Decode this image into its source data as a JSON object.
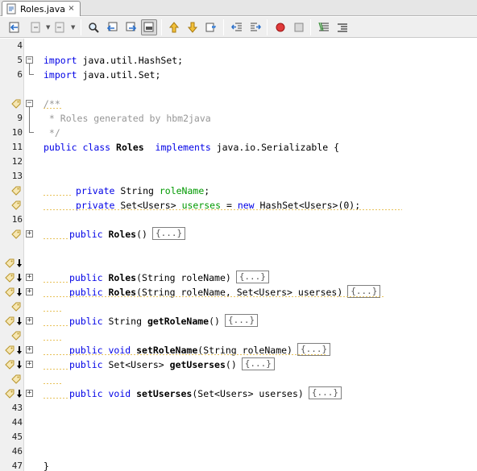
{
  "tab": {
    "label": "Roles.java",
    "close": "×"
  },
  "toolbar": {
    "buttons": [
      "last-edit-icon",
      "back-icon",
      "forward-icon",
      "find-selection-icon",
      "find-previous-icon",
      "find-next-icon",
      "toggle-highlight-icon",
      "previous-bookmark-icon",
      "next-bookmark-icon",
      "toggle-bookmark-icon",
      "shift-left-icon",
      "shift-right-icon",
      "record-macro-icon",
      "stop-macro-icon",
      "comment-icon",
      "uncomment-icon"
    ]
  },
  "editor": {
    "lines": [
      {
        "num": "4",
        "text": ""
      },
      {
        "num": "5",
        "text": "import java.util.HashSet;"
      },
      {
        "num": "6",
        "text": "import java.util.Set;"
      },
      {
        "num": "",
        "text": ""
      },
      {
        "num": "",
        "text": "/**"
      },
      {
        "num": "9",
        "text": " * Roles generated by hbm2java"
      },
      {
        "num": "10",
        "text": " */"
      },
      {
        "num": "11",
        "text": "public class Roles  implements java.io.Serializable {"
      },
      {
        "num": "12",
        "text": ""
      },
      {
        "num": "13",
        "text": ""
      },
      {
        "num": "",
        "text": "private String roleName;"
      },
      {
        "num": "",
        "text": "private Set<Users> userses = new HashSet<Users>(0);"
      },
      {
        "num": "16",
        "text": ""
      },
      {
        "num": "",
        "text": "public Roles()"
      },
      {
        "num": "",
        "text": ""
      },
      {
        "num": "",
        "text": ""
      },
      {
        "num": "",
        "text": "public Roles(String roleName)"
      },
      {
        "num": "",
        "text": "public Roles(String roleName, Set<Users> userses)"
      },
      {
        "num": "",
        "text": ""
      },
      {
        "num": "",
        "text": "public String getRoleName()"
      },
      {
        "num": "",
        "text": ""
      },
      {
        "num": "",
        "text": "public void setRoleName(String roleName)"
      },
      {
        "num": "",
        "text": "public Set<Users> getUserses()"
      },
      {
        "num": "",
        "text": ""
      },
      {
        "num": "",
        "text": "public void setUserses(Set<Users> userses)"
      },
      {
        "num": "43",
        "text": ""
      },
      {
        "num": "44",
        "text": ""
      },
      {
        "num": "45",
        "text": ""
      },
      {
        "num": "46",
        "text": ""
      },
      {
        "num": "47",
        "text": "}"
      }
    ],
    "collapsed_label": "{...}",
    "fold_expand": "+",
    "fold_collapse": "−",
    "tokens": {
      "import": "import",
      "pkg_hashset": " java.util.HashSet;",
      "pkg_set": " java.util.Set;",
      "cm_open": "/**",
      "cm_body": " * Roles generated by hbm2java",
      "cm_close": " */",
      "public": "public",
      "class": "class",
      "roles": "Roles",
      "implements": "implements",
      "serializable": " java.io.Serializable {",
      "private": "private",
      "string": " String ",
      "roleName": "roleName",
      "semi": ";",
      "setUsers": " Set<Users> ",
      "userses": "userses",
      "eqnew": " = ",
      "new": "new",
      "hashset": " HashSet<Users>(0);",
      "parens": "()",
      "ctor1_args": "(String roleName)",
      "ctor2_args": "(String roleName, Set<Users> userses)",
      "string_sp": " String ",
      "getRoleName": "getRoleName",
      "void": " void ",
      "setRoleName": "setRoleName",
      "setRoleName_args": "(String roleName)",
      "setUsers_ret": " Set<Users> ",
      "getUserses": "getUserses",
      "setUserses": "setUserses",
      "setUserses_args": "(Set<Users> userses)",
      "space": " ",
      "close_brace": "}"
    }
  }
}
